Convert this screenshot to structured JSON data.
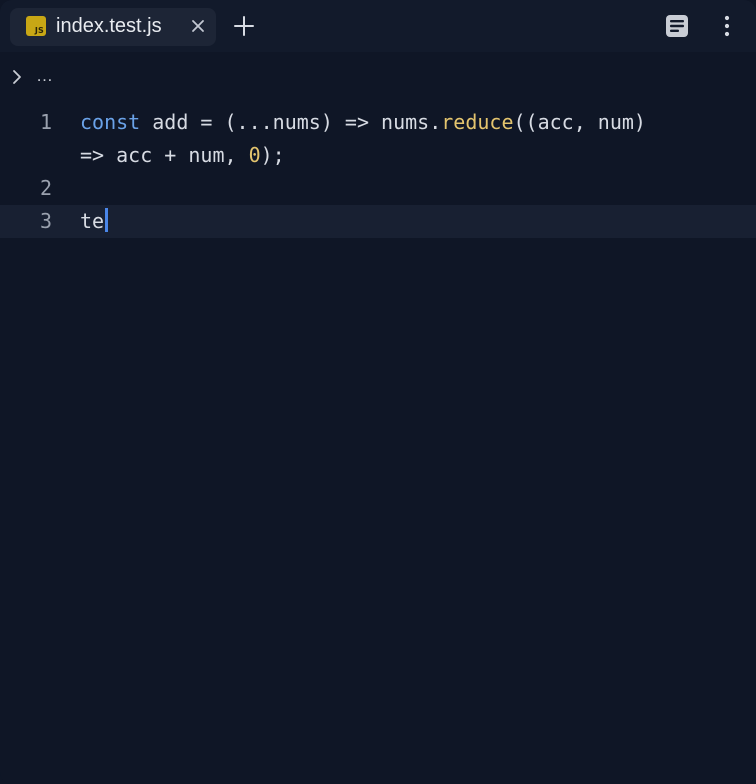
{
  "tab": {
    "title": "index.test.js",
    "badge": "JS"
  },
  "breadcrumb": {
    "text": "…"
  },
  "editor": {
    "lines": [
      {
        "number": "1",
        "tokens": [
          {
            "text": "const",
            "kind": "keyword"
          },
          {
            "text": " add = (...nums) => nums.",
            "kind": "plain"
          },
          {
            "text": "reduce",
            "kind": "function"
          },
          {
            "text": "((acc, num)",
            "kind": "plain"
          }
        ],
        "wrap_tokens": [
          {
            "text": "=> acc + num, ",
            "kind": "plain"
          },
          {
            "text": "0",
            "kind": "number"
          },
          {
            "text": ");",
            "kind": "plain"
          }
        ]
      },
      {
        "number": "2",
        "tokens": []
      },
      {
        "number": "3",
        "tokens": [
          {
            "text": "te",
            "kind": "plain"
          }
        ]
      }
    ]
  },
  "colors": {
    "background": "#0f1626",
    "keyword": "#6aa2e8",
    "function": "#e3c46e",
    "caret": "#4a86e8"
  },
  "icons": {
    "close": "close-icon",
    "add": "plus-icon",
    "panel": "panel-icon",
    "more": "more-vertical-icon",
    "chevron": "chevron-right-icon"
  }
}
